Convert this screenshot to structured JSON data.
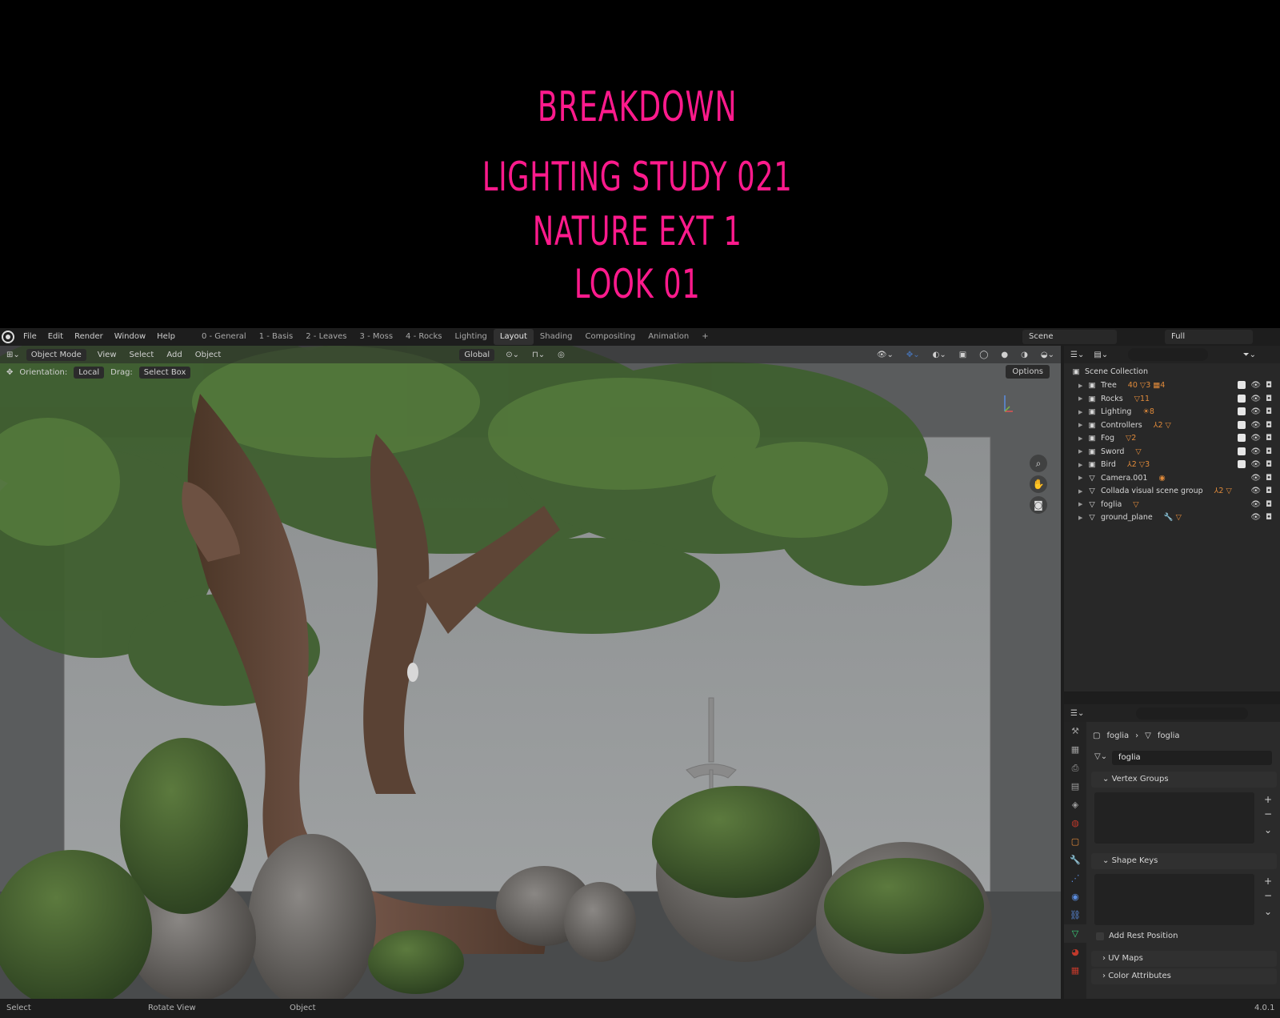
{
  "banner": {
    "line1": "BREAKDOWN",
    "line2": "LIGHTING  STUDY  021",
    "line3": "NATURE EXT 1",
    "line4": "LOOK 01"
  },
  "menu": [
    "File",
    "Edit",
    "Render",
    "Window",
    "Help"
  ],
  "workspaces": [
    "0 - General",
    "1 - Basis",
    "2 - Leaves",
    "3 - Moss",
    "4 - Rocks",
    "Lighting",
    "Layout",
    "Shading",
    "Compositing",
    "Animation"
  ],
  "active_workspace": "Layout",
  "add_tab": "+",
  "scene": "Scene",
  "view_layer": "Full",
  "viewport_header": {
    "mode": "Object Mode",
    "menus": [
      "View",
      "Select",
      "Add",
      "Object"
    ],
    "transform_orientation": "Global"
  },
  "tool_settings": {
    "orientation_label": "Orientation:",
    "orientation_value": "Local",
    "drag_label": "Drag:",
    "drag_value": "Select Box"
  },
  "options": "Options",
  "outliner": {
    "root": "Scene Collection",
    "items": [
      {
        "name": "Tree",
        "extra": "40 ▽3 ▦4",
        "checked": true
      },
      {
        "name": "Rocks",
        "extra": "▽11",
        "checked": true
      },
      {
        "name": "Lighting",
        "extra": "☀8",
        "checked": true
      },
      {
        "name": "Controllers",
        "extra": "⅄2 ▽",
        "checked": true
      },
      {
        "name": "Fog",
        "extra": "▽2",
        "checked": true
      },
      {
        "name": "Sword",
        "extra": "▽",
        "checked": true
      },
      {
        "name": "Bird",
        "extra": "⅄2 ▽3",
        "checked": true
      },
      {
        "name": "Camera.001",
        "extra": "◉",
        "checked": false
      },
      {
        "name": "Collada visual scene group",
        "extra": "⅄2 ▽",
        "checked": false
      },
      {
        "name": "foglia",
        "extra": "▽",
        "checked": false
      },
      {
        "name": "ground_plane",
        "extra": "🔧 ▽",
        "checked": false
      }
    ]
  },
  "properties": {
    "breadcrumb_object": "foglia",
    "breadcrumb_data": "foglia",
    "mesh_name": "foglia",
    "panels": {
      "vertex_groups": "Vertex Groups",
      "shape_keys": "Shape Keys",
      "add_rest_position": "Add Rest Position",
      "uv_maps": "UV Maps",
      "color_attributes": "Color Attributes"
    }
  },
  "statusbar": {
    "select": "Select",
    "rotate": "Rotate View",
    "object": "Object",
    "version": "4.0.1"
  },
  "icons": {
    "properties_tabs": [
      "tool-icon",
      "render-icon",
      "output-icon",
      "view-layer-icon",
      "scene-icon",
      "world-icon",
      "object-icon",
      "modifier-icon",
      "particles-icon",
      "physics-icon",
      "constraints-icon",
      "data-icon",
      "material-icon",
      "tex…-icon"
    ]
  },
  "colors": {
    "banner_text": "#ff1a8c",
    "ui_bg": "#1d1d1d",
    "panel_bg": "#2b2b2b",
    "active_blue": "#4772b3",
    "mesh_orange": "#e08a3a"
  }
}
